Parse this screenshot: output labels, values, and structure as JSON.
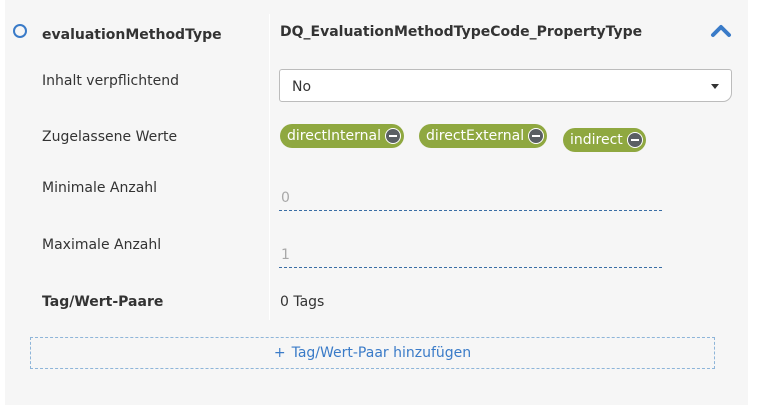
{
  "property": {
    "name": "evaluationMethodType",
    "type": "DQ_EvaluationMethodTypeCode_PropertyType",
    "collapse_icon": "chevron-up-icon",
    "accent_color": "#3a7bc8"
  },
  "fields": {
    "mandatory": {
      "label": "Inhalt verpflichtend",
      "value": "No"
    },
    "allowed_values": {
      "label": "Zugelassene Werte",
      "tags": [
        "directInternal",
        "directExternal",
        "indirect"
      ],
      "tag_color": "#8fa840"
    },
    "min_count": {
      "label": "Minimale Anzahl",
      "value": "0"
    },
    "max_count": {
      "label": "Maximale Anzahl",
      "value": "1"
    },
    "tag_pairs": {
      "label": "Tag/Wert-Paare",
      "value": "0 Tags"
    }
  },
  "add_button": {
    "icon": "+",
    "label": "Tag/Wert-Paar hinzufügen"
  }
}
